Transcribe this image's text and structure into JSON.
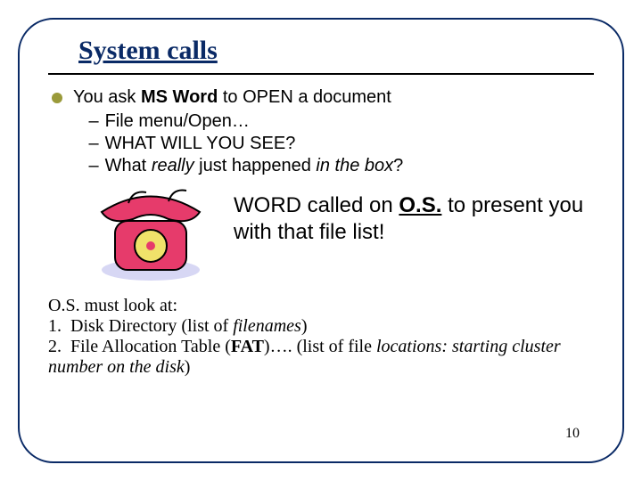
{
  "title": "System calls",
  "bullet_main_pre": "You ask ",
  "bullet_main_bold": "MS Word",
  "bullet_main_post": " to OPEN a document",
  "sub1": "File menu/Open…",
  "sub2": "WHAT WILL YOU SEE?",
  "sub3_pre": "What ",
  "sub3_em1": "really",
  "sub3_mid": " just happened ",
  "sub3_em2": "in the box",
  "sub3_q": "?",
  "msg_pre": "WORD called on ",
  "msg_os": "O.S.",
  "msg_post": " to present you with that file list!",
  "look_intro": "O.S. must look at:",
  "look1_pre": "Disk Directory (list of ",
  "look1_em": "filenames",
  "look1_post": ")",
  "look2_pre": "File Allocation Table (",
  "look2_bold": "FAT",
  "look2_mid": ")…. (list of file ",
  "look2_em1": "locations: starting cluster number on the disk",
  "look2_post": ")",
  "page_number": "10",
  "icon_name": "telephone-clipart-icon"
}
